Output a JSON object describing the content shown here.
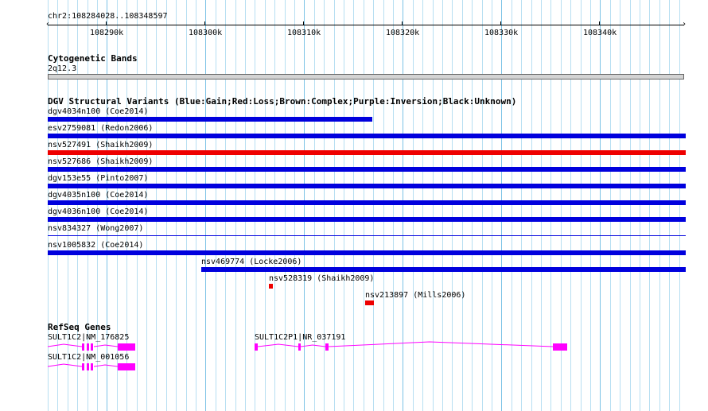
{
  "ruler": {
    "title": "chr2:108284028..108348597",
    "ticks": [
      "108290k",
      "108300k",
      "108310k",
      "108320k",
      "108330k",
      "108340k"
    ]
  },
  "cytoband": {
    "title": "Cytogenetic Bands",
    "band": "2q12.3"
  },
  "dgv": {
    "title": "DGV Structural Variants (Blue:Gain;Red:Loss;Brown:Complex;Purple:Inversion;Black:Unknown)",
    "colors": {
      "gain": "#0000dd",
      "loss": "#ee0000"
    },
    "variants": [
      {
        "label": "dgv4034n100 (Coe2014)",
        "type": "gain"
      },
      {
        "label": "esv2759081 (Redon2006)",
        "type": "gain"
      },
      {
        "label": "nsv527491 (Shaikh2009)",
        "type": "loss"
      },
      {
        "label": "nsv527686 (Shaikh2009)",
        "type": "gain"
      },
      {
        "label": "dgv153e55 (Pinto2007)",
        "type": "gain"
      },
      {
        "label": "dgv4035n100 (Coe2014)",
        "type": "gain"
      },
      {
        "label": "dgv4036n100 (Coe2014)",
        "type": "gain"
      },
      {
        "label": "nsv834327 (Wong2007)",
        "type": "gain"
      },
      {
        "label": "nsv1005832 (Coe2014)",
        "type": "gain"
      },
      {
        "label": "nsv469774 (Locke2006)",
        "type": "gain"
      },
      {
        "label": "nsv528319 (Shaikh2009)",
        "type": "loss"
      },
      {
        "label": "nsv213897 (Mills2006)",
        "type": "loss"
      }
    ]
  },
  "refseq": {
    "title": "RefSeq Genes",
    "color": "#ff00ff",
    "genes": [
      {
        "label": "SULT1C2|NM_176825"
      },
      {
        "label": "SULT1C2|NM_001056"
      },
      {
        "label": "SULT1C2P1|NR_037191"
      }
    ]
  }
}
